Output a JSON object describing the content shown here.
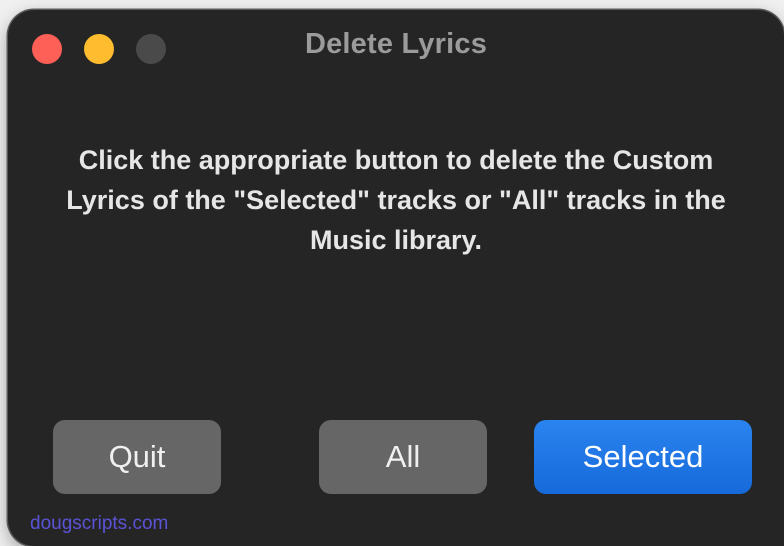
{
  "window": {
    "title": "Delete Lyrics",
    "traffic_lights": {
      "close": {
        "icon": "close-dot-icon",
        "color": "#fe5f57"
      },
      "minimize": {
        "icon": "minimize-dot-icon",
        "color": "#febc2e"
      },
      "zoom": {
        "icon": "zoom-dot-icon",
        "color": "#4a4a4a",
        "enabled": false
      }
    }
  },
  "dialog": {
    "message": "Click the appropriate button to delete the Custom Lyrics of the \"Selected\" tracks or \"All\" tracks in the Music library.",
    "buttons": {
      "quit": "Quit",
      "all": "All",
      "selected": "Selected"
    }
  },
  "footer": {
    "link_text": "dougscripts.com"
  },
  "colors": {
    "window_bg": "#252525",
    "default_button": "#1e75e6",
    "gray_button": "#666666",
    "link": "#5b53d6"
  }
}
